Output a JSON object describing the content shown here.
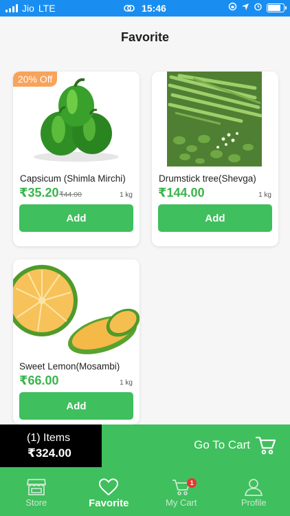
{
  "status_bar": {
    "carrier": "Jio",
    "network": "LTE",
    "time": "15:46"
  },
  "header": {
    "title": "Favorite"
  },
  "products": [
    {
      "image": "green-capsicum-image",
      "badge": "20% Off",
      "name": "Capsicum (Shimla Mirchi)",
      "price": "₹35.20",
      "old_price": "₹44.00",
      "unit": "1 kg",
      "add_label": "Add"
    },
    {
      "image": "drumstick-beans-image",
      "name": "Drumstick tree(Shevga)",
      "price": "₹144.00",
      "unit": "1 kg",
      "add_label": "Add"
    },
    {
      "image": "sweet-lemon-image",
      "name": "Sweet Lemon(Mosambi)",
      "price": "₹66.00",
      "unit": "1 kg",
      "add_label": "Add"
    }
  ],
  "cart_bar": {
    "items_count": "(1) Items",
    "total": "₹324.00",
    "go_to_cart_label": "Go To Cart"
  },
  "nav": {
    "items": [
      {
        "label": "Store",
        "icon": "store-icon",
        "active": false
      },
      {
        "label": "Favorite",
        "icon": "heart-icon",
        "active": true
      },
      {
        "label": "My Cart",
        "icon": "cart-icon",
        "active": false,
        "badge": "1"
      },
      {
        "label": "Profile",
        "icon": "person-icon",
        "active": false
      }
    ]
  },
  "colors": {
    "accent": "#3fbf5d",
    "price": "#39b54a",
    "badge": "#f7a35b",
    "status_bar": "#1a8ef0"
  }
}
